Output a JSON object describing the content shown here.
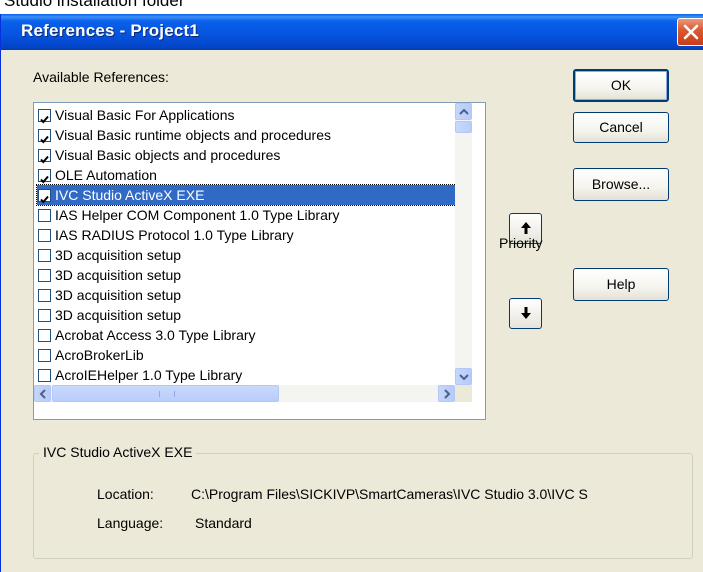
{
  "top_text": "Studio installation folder",
  "window": {
    "title": "References - Project1"
  },
  "available_label": "Available References:",
  "references": [
    {
      "label": "Visual Basic For Applications",
      "checked": true,
      "selected": false
    },
    {
      "label": "Visual Basic runtime objects and procedures",
      "checked": true,
      "selected": false
    },
    {
      "label": "Visual Basic objects and procedures",
      "checked": true,
      "selected": false
    },
    {
      "label": "OLE Automation",
      "checked": true,
      "selected": false
    },
    {
      "label": "IVC Studio ActiveX EXE",
      "checked": true,
      "selected": true
    },
    {
      "label": "IAS Helper COM Component 1.0 Type Library",
      "checked": false,
      "selected": false
    },
    {
      "label": "IAS RADIUS Protocol 1.0 Type Library",
      "checked": false,
      "selected": false
    },
    {
      "label": "3D acquisition setup",
      "checked": false,
      "selected": false
    },
    {
      "label": "3D acquisition setup",
      "checked": false,
      "selected": false
    },
    {
      "label": "3D acquisition setup",
      "checked": false,
      "selected": false
    },
    {
      "label": "3D acquisition setup",
      "checked": false,
      "selected": false
    },
    {
      "label": "Acrobat Access 3.0 Type Library",
      "checked": false,
      "selected": false
    },
    {
      "label": "AcroBrokerLib",
      "checked": false,
      "selected": false
    },
    {
      "label": "AcroIEHelper 1.0 Type Library",
      "checked": false,
      "selected": false
    }
  ],
  "buttons": {
    "ok": "OK",
    "cancel": "Cancel",
    "browse": "Browse...",
    "help": "Help"
  },
  "priority_label": "Priority",
  "details": {
    "group_title": "IVC Studio ActiveX EXE",
    "location_label": "Location:",
    "location_value": "C:\\Program Files\\SICKIVP\\SmartCameras\\IVC Studio 3.0\\IVC S",
    "language_label": "Language:",
    "language_value": "Standard"
  },
  "colors": {
    "titlebar": "#0553df",
    "selection": "#316ac5",
    "dialog_bg": "#ece9d8",
    "close_button": "#dd5a33"
  }
}
